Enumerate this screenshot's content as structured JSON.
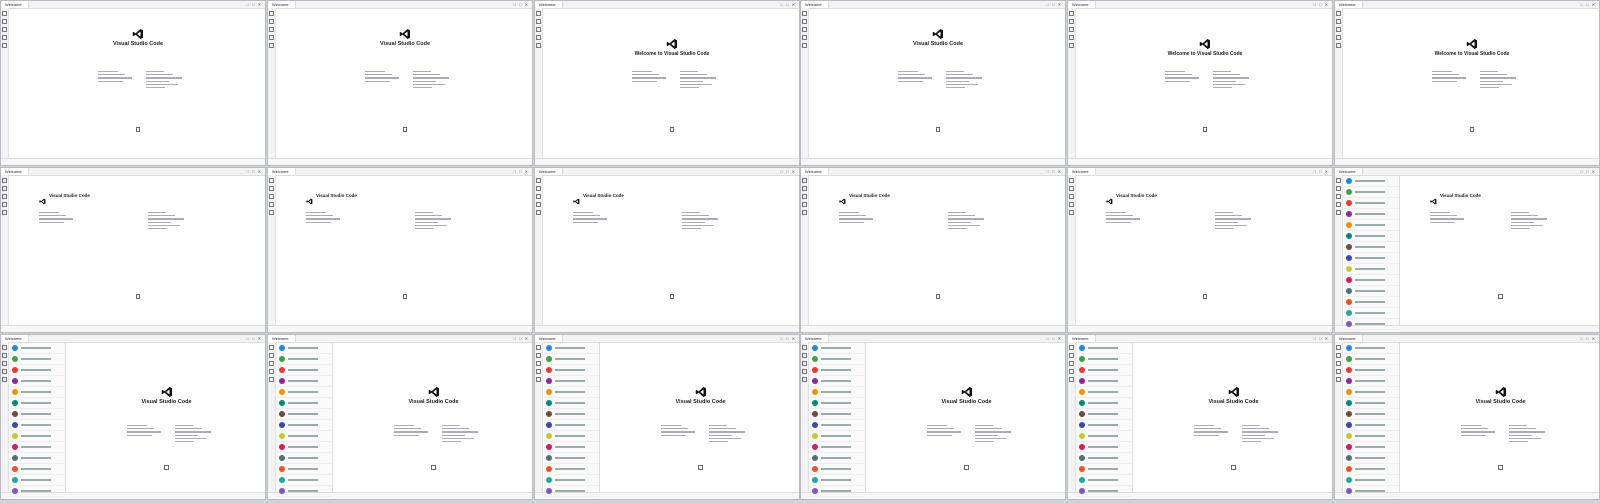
{
  "screenshot": {
    "window_title": "Welcome",
    "window_controls": "□ □ ✕",
    "product_name": "Visual Studio Code",
    "welcome_title": "Welcome to Visual Studio Code",
    "accent": "#0065a9",
    "icons": [
      "explorer-icon",
      "search-icon",
      "source-control-icon",
      "run-icon",
      "extensions-icon",
      "account-icon",
      "settings-icon"
    ]
  }
}
